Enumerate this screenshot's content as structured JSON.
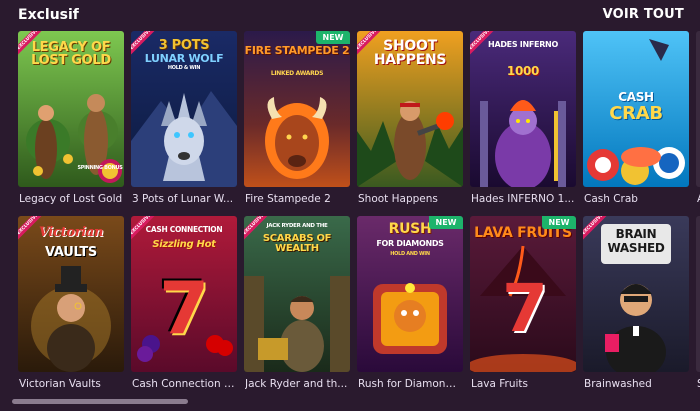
{
  "section": {
    "title": "Exclusif",
    "see_all": "VOIR TOUT"
  },
  "badges": {
    "new": "NEW",
    "exclusive": "EXCLUSIVE"
  },
  "row1": [
    {
      "name": "Legacy of Lost Gold",
      "art_title": "LEGACY OF LOST GOLD",
      "art_sub": "SPINNING BONUS",
      "exclusive": true,
      "new": false
    },
    {
      "name": "3 Pots of Lunar W...",
      "art_title": "3 POTS",
      "art_sub": "LUNAR WOLF",
      "art_tag": "HOLD & WIN",
      "exclusive": true,
      "new": false
    },
    {
      "name": "Fire Stampede 2",
      "art_title": "FIRE STAMPEDE 2",
      "art_sub": "LINKED AWARDS",
      "exclusive": false,
      "new": true
    },
    {
      "name": "Shoot Happens",
      "art_title": "SHOOT HAPPENS",
      "exclusive": true,
      "new": false
    },
    {
      "name": "Hades INFERNO 1...",
      "art_title": "HADES INFERNO",
      "art_sub": "1000",
      "exclusive": true,
      "new": false
    },
    {
      "name": "Cash Crab",
      "art_title": "CASH",
      "art_sub": "CRAB",
      "exclusive": false,
      "new": false
    },
    {
      "name": "A",
      "exclusive": false,
      "new": false
    }
  ],
  "row2": [
    {
      "name": "Victorian Vaults",
      "art_title": "Victorian",
      "art_sub": "VAULTS",
      "exclusive": true,
      "new": false
    },
    {
      "name": "Cash Connection S...",
      "art_title": "CASH CONNECTION",
      "art_sub": "Sizzling Hot",
      "art_num": "7",
      "exclusive": true,
      "new": false
    },
    {
      "name": "Jack Ryder and th...",
      "art_title": "JACK RYDER AND THE",
      "art_sub": "SCARABS OF WEALTH",
      "exclusive": true,
      "new": false
    },
    {
      "name": "Rush for Diamond...",
      "art_title": "RUSH",
      "art_sub": "FOR DIAMONDS",
      "art_tag": "HOLD AND WIN",
      "exclusive": false,
      "new": true
    },
    {
      "name": "Lava Fruits",
      "art_title": "LAVA FRUITS",
      "art_num": "7",
      "exclusive": false,
      "new": true
    },
    {
      "name": "Brainwashed",
      "art_title": "BRAIN",
      "art_sub": "WASHED",
      "exclusive": true,
      "new": false
    },
    {
      "name": "S",
      "exclusive": false,
      "new": false
    }
  ],
  "colors": {
    "background": "#2a1a2e",
    "new_badge": "#1db46b",
    "exclusive_band": "#d81b60",
    "label": "#e8dff0"
  }
}
